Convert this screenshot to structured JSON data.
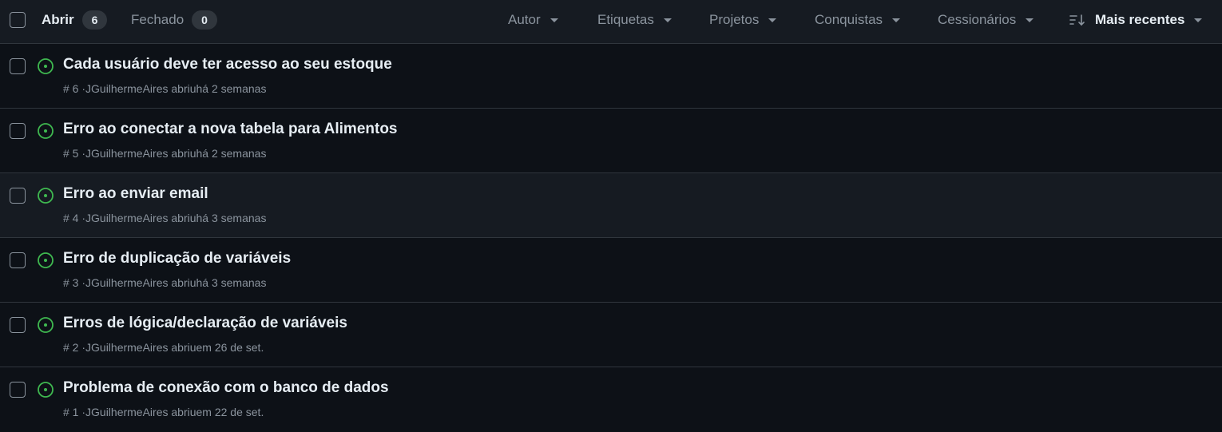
{
  "toolbar": {
    "open_label": "Abrir",
    "open_count": "6",
    "closed_label": "Fechado",
    "closed_count": "0",
    "filters": [
      "Autor",
      "Etiquetas",
      "Projetos",
      "Conquistas",
      "Cessionários"
    ],
    "sort_label": "Mais recentes"
  },
  "issues": [
    {
      "title": "Cada usuário deve ter acesso ao seu estoque",
      "meta": "# 6 ·JGuilhermeAires abriuhá 2 semanas"
    },
    {
      "title": "Erro ao conectar a nova tabela para Alimentos",
      "meta": "# 5 ·JGuilhermeAires abriuhá 2 semanas"
    },
    {
      "title": "Erro ao enviar email",
      "meta": "# 4 ·JGuilhermeAires abriuhá 3 semanas"
    },
    {
      "title": "Erro de duplicação de variáveis",
      "meta": "# 3 ·JGuilhermeAires abriuhá 3 semanas"
    },
    {
      "title": "Erros de lógica/declaração de variáveis",
      "meta": "# 2 ·JGuilhermeAires abriuem 26 de set."
    },
    {
      "title": "Problema de conexão com o banco de dados",
      "meta": "# 1 ·JGuilhermeAires abriuem 22 de set."
    }
  ],
  "colors": {
    "background": "#0d1117",
    "toolbar": "#161b22",
    "border": "#30363d",
    "open_icon": "#3fb950",
    "muted_text": "#8b949e",
    "text": "#e6edf3"
  }
}
